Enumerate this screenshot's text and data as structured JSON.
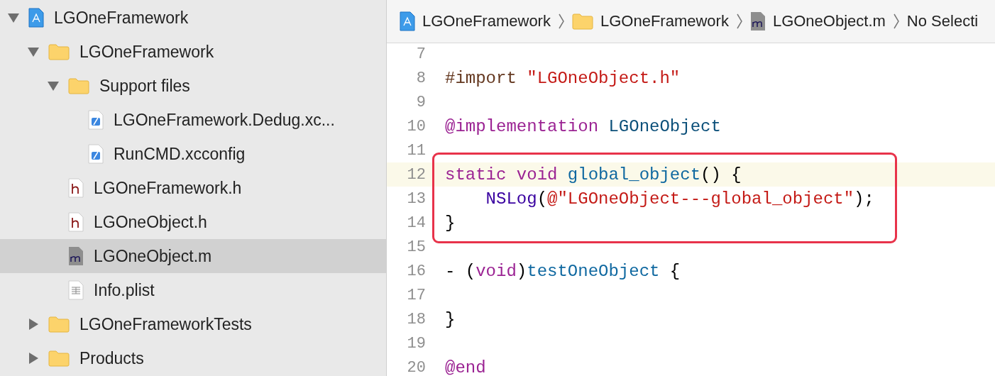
{
  "navigator": {
    "items": [
      {
        "label": "LGOneFramework",
        "kind": "project",
        "expanded": true,
        "selected": false,
        "children": [
          {
            "label": "LGOneFramework",
            "kind": "folder",
            "expanded": true,
            "selected": false,
            "children": [
              {
                "label": "Support files",
                "kind": "folder",
                "expanded": true,
                "selected": false,
                "children": [
                  {
                    "label": "LGOneFramework.Dedug.xc...",
                    "kind": "xcconfig",
                    "selected": false
                  },
                  {
                    "label": "RunCMD.xcconfig",
                    "kind": "xcconfig",
                    "selected": false
                  }
                ]
              },
              {
                "label": "LGOneFramework.h",
                "kind": "header",
                "selected": false
              },
              {
                "label": "LGOneObject.h",
                "kind": "header",
                "selected": false
              },
              {
                "label": "LGOneObject.m",
                "kind": "source",
                "selected": true
              },
              {
                "label": "Info.plist",
                "kind": "plist",
                "selected": false
              }
            ]
          },
          {
            "label": "LGOneFrameworkTests",
            "kind": "folder",
            "expanded": false,
            "selected": false
          },
          {
            "label": "Products",
            "kind": "folder",
            "expanded": false,
            "selected": false
          }
        ]
      }
    ]
  },
  "breadcrumb": [
    {
      "label": "LGOneFramework",
      "kind": "project"
    },
    {
      "label": "LGOneFramework",
      "kind": "folder"
    },
    {
      "label": "LGOneObject.m",
      "kind": "source"
    },
    {
      "label": "No Selecti",
      "kind": "text"
    }
  ],
  "editor": {
    "lines": [
      {
        "number": "7",
        "current": false,
        "boxed": false
      },
      {
        "number": "8",
        "current": false,
        "boxed": false,
        "tokens": [
          {
            "text": "#import",
            "kind": "directive"
          },
          {
            "text": " \"LGOneObject.h\"",
            "kind": "string"
          }
        ]
      },
      {
        "number": "9",
        "current": false,
        "boxed": false
      },
      {
        "number": "10",
        "current": false,
        "boxed": false,
        "tokens": [
          {
            "text": "@implementation",
            "kind": "keyword"
          },
          {
            "text": " LGOneObject",
            "kind": "type"
          }
        ]
      },
      {
        "number": "11",
        "current": false,
        "boxed": false
      },
      {
        "number": "12",
        "current": true,
        "boxed": true,
        "tokens": [
          {
            "text": "static",
            "kind": "keyword"
          },
          {
            "text": " void",
            "kind": "keyword"
          },
          {
            "text": " global_object",
            "kind": "function"
          },
          {
            "text": "() {",
            "kind": "plain"
          }
        ]
      },
      {
        "number": "13",
        "current": false,
        "boxed": true,
        "tokens": [
          {
            "text": "    NSLog",
            "kind": "system"
          },
          {
            "text": "(",
            "kind": "plain"
          },
          {
            "text": "@\"LGOneObject---global_object\"",
            "kind": "string"
          },
          {
            "text": ");",
            "kind": "plain"
          }
        ]
      },
      {
        "number": "14",
        "current": false,
        "boxed": true,
        "tokens": [
          {
            "text": "}",
            "kind": "plain"
          }
        ]
      },
      {
        "number": "15",
        "current": false,
        "boxed": false
      },
      {
        "number": "16",
        "current": false,
        "boxed": false,
        "tokens": [
          {
            "text": "- (",
            "kind": "plain"
          },
          {
            "text": "void",
            "kind": "keyword"
          },
          {
            "text": ")",
            "kind": "plain"
          },
          {
            "text": "testOneObject",
            "kind": "function"
          },
          {
            "text": " {",
            "kind": "plain"
          }
        ]
      },
      {
        "number": "17",
        "current": false,
        "boxed": false
      },
      {
        "number": "18",
        "current": false,
        "boxed": false,
        "tokens": [
          {
            "text": "}",
            "kind": "plain"
          }
        ]
      },
      {
        "number": "19",
        "current": false,
        "boxed": false
      },
      {
        "number": "20",
        "current": false,
        "boxed": false,
        "tokens": [
          {
            "text": "@end",
            "kind": "keyword"
          }
        ]
      }
    ]
  }
}
